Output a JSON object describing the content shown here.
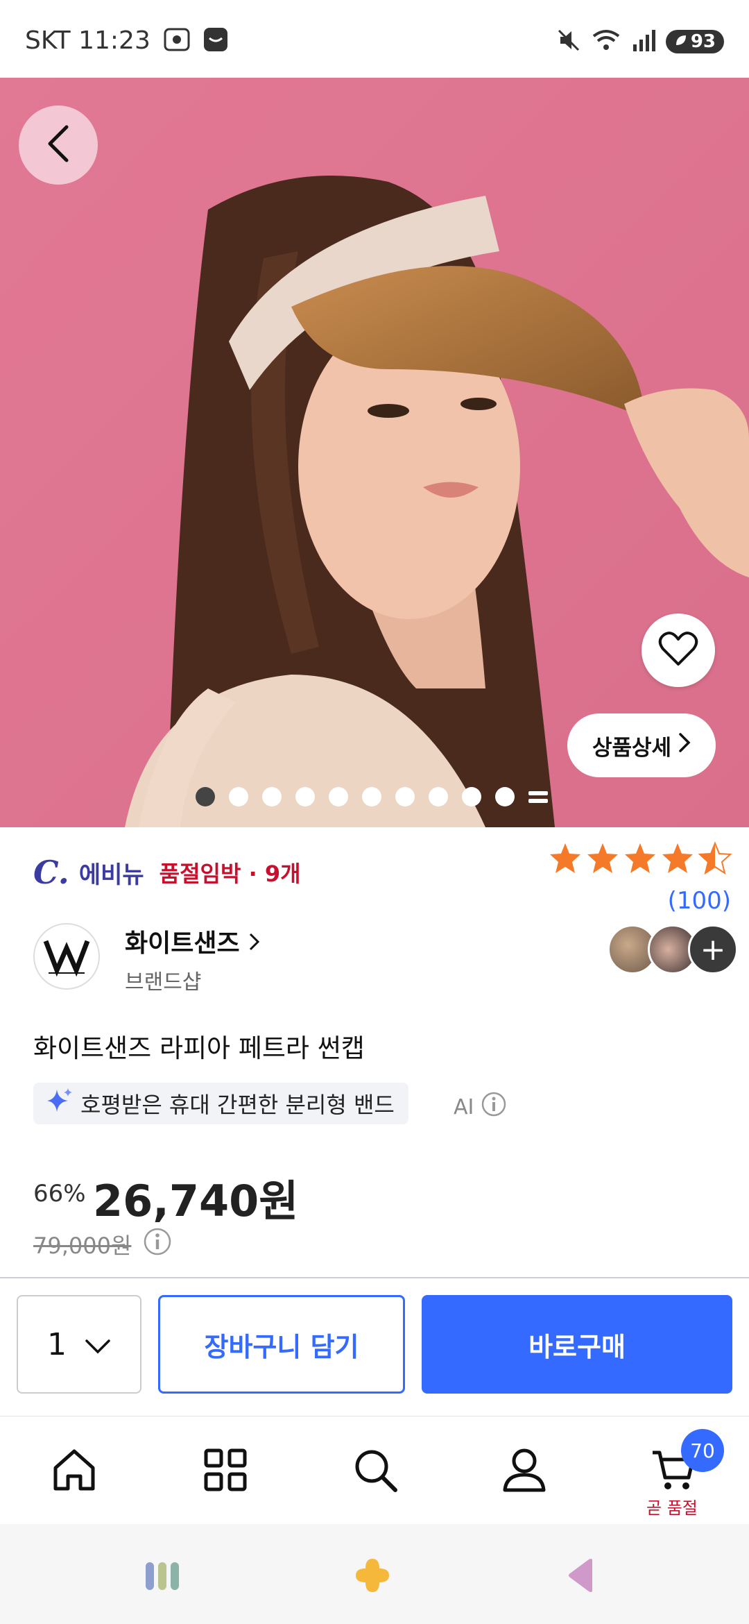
{
  "status_bar": {
    "carrier_time": "SKT 11:23",
    "battery": "93"
  },
  "hero": {
    "detail_label": "상품상세",
    "total_images": 10,
    "active_index": 0
  },
  "product": {
    "badge_letter": "C.",
    "badge_name": "에비뉴",
    "stock_status": "품절임박 · 9개",
    "rating": 4.5,
    "review_count": "(100)",
    "brand_name": "화이트샌즈",
    "brand_sub": "브랜드샵",
    "title": "화이트샌즈 라피아 페트라 썬캡",
    "ai_summary": "호평받은 휴대 간편한 분리형 밴드",
    "ai_label": "AI",
    "discount": "66%",
    "price": "26,740원",
    "original_price": "79,000원",
    "avatar_more": "+"
  },
  "actions": {
    "quantity": "1",
    "cart_label": "장바구니 담기",
    "buy_label": "바로구매"
  },
  "bottom_nav": {
    "cart_count": "70",
    "cart_note": "곧 품절"
  },
  "colors": {
    "primary": "#346aff",
    "stock_red": "#c8102e",
    "badge_purple": "#3c3ba1",
    "star": "#f47a2a"
  }
}
